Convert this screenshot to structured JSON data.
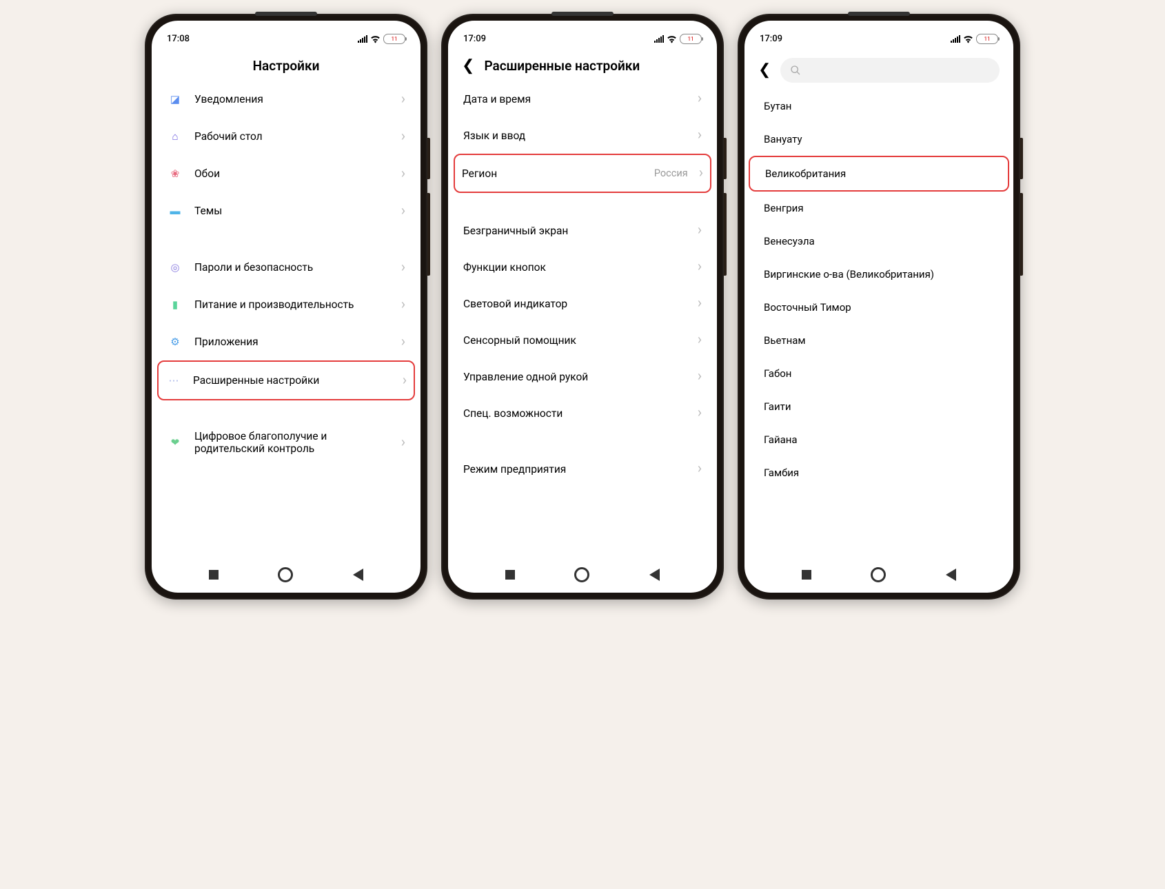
{
  "status": {
    "time1": "17:08",
    "time2": "17:09",
    "time3": "17:09",
    "battery": "11"
  },
  "phone1": {
    "title": "Настройки",
    "items_a": [
      {
        "label": "Уведомления",
        "icon_color": "#5b8def"
      },
      {
        "label": "Рабочий стол",
        "icon_color": "#6b5bdf"
      },
      {
        "label": "Обои",
        "icon_color": "#e8697e"
      },
      {
        "label": "Темы",
        "icon_color": "#4fb4e8"
      }
    ],
    "items_b": [
      {
        "label": "Пароли и безопасность",
        "icon_color": "#8a7ce0"
      },
      {
        "label": "Питание и производительность",
        "icon_color": "#5bd49b"
      },
      {
        "label": "Приложения",
        "icon_color": "#4a9ee8"
      },
      {
        "label": "Расширенные настройки",
        "icon_color": "#a8b4e8",
        "highlight": true
      }
    ],
    "items_c": [
      {
        "label": "Цифровое благополучие и родительский контроль",
        "icon_color": "#6bcf8f"
      }
    ]
  },
  "phone2": {
    "title": "Расширенные настройки",
    "items_a": [
      {
        "label": "Дата и время"
      },
      {
        "label": "Язык и ввод"
      },
      {
        "label": "Регион",
        "value": "Россия",
        "highlight": true
      }
    ],
    "items_b": [
      {
        "label": "Безграничный экран"
      },
      {
        "label": "Функции кнопок"
      },
      {
        "label": "Световой индикатор"
      },
      {
        "label": "Сенсорный помощник"
      },
      {
        "label": "Управление одной рукой"
      },
      {
        "label": "Спец. возможности"
      }
    ],
    "items_c": [
      {
        "label": "Режим предприятия"
      }
    ]
  },
  "phone3": {
    "countries": [
      "Бутан",
      "Вануату",
      "Великобритания",
      "Венгрия",
      "Венесуэла",
      "Виргинские о-ва (Великобритания)",
      "Восточный Тимор",
      "Вьетнам",
      "Габон",
      "Гаити",
      "Гайана",
      "Гамбия"
    ],
    "highlight_index": 2
  }
}
